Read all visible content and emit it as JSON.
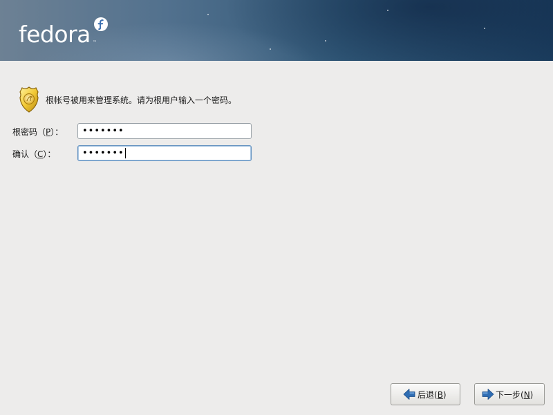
{
  "header": {
    "logo_text": "fedora",
    "logo_tm": "™",
    "logo_icon": "fedora-infinity-f-icon",
    "colors": {
      "banner_dark": "#1a3b5c",
      "banner_light": "#6d8194",
      "logo": "#ffffff"
    }
  },
  "intro": {
    "icon": "police-badge-icon",
    "text": "根帐号被用来管理系统。请为根用户输入一个密码。"
  },
  "form": {
    "root_password": {
      "label_prefix": "根密码（",
      "mnemonic": "P",
      "label_suffix": "）：",
      "value": "•••••••"
    },
    "confirm": {
      "label_prefix": "确认（",
      "mnemonic": "C",
      "label_suffix": "）：",
      "value": "•••••••",
      "focused": true
    }
  },
  "buttons": {
    "back": {
      "prefix": "后退(",
      "mnemonic": "B",
      "suffix": ")",
      "icon": "arrow-left-icon"
    },
    "next": {
      "prefix": "下一步(",
      "mnemonic": "N",
      "suffix": ")",
      "icon": "arrow-right-icon"
    }
  },
  "colors": {
    "background": "#edeceb",
    "focus_border": "#5f8fbf",
    "arrow_blue": "#2f6db3"
  }
}
